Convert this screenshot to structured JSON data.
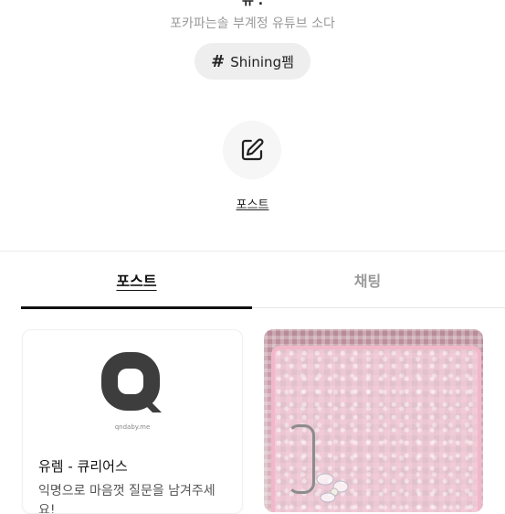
{
  "profile": {
    "name_partial": "유 .",
    "subtitle": "포카파는솔 부계정 유튜브 소다",
    "tag": {
      "symbol": "#",
      "label": "Shining펨"
    }
  },
  "actions": {
    "post_label": "포스트"
  },
  "tabs": [
    {
      "label": "포스트",
      "active": true
    },
    {
      "label": "채팅",
      "active": false
    }
  ],
  "cards": [
    {
      "logo_text": "qndaby.me",
      "title": "유렘 - 큐리어스",
      "description": "익명으로 마음껏 질문을 남겨주세요!"
    },
    {
      "image": "pink-card-holder-photo"
    }
  ],
  "colors": {
    "chip_bg": "#eeeeee",
    "active_tab": "#111111",
    "inactive_tab": "#9a9a9a",
    "subtitle": "#9a9a9a"
  }
}
